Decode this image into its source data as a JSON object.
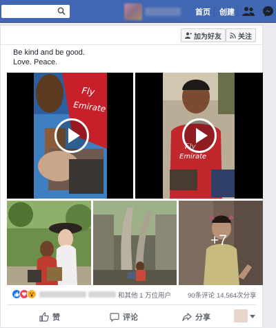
{
  "topbar": {
    "search_placeholder": "",
    "nav": {
      "home": "首页",
      "create": "创建"
    }
  },
  "post": {
    "header_buttons": {
      "add_friend": "加为好友",
      "follow": "关注"
    },
    "text_line1": "Be kind and be good.",
    "text_line2": "Love. Peace.",
    "more_photos": "+7"
  },
  "stats": {
    "others": "和其他 1 万位用户",
    "comments": "90条评论",
    "shares": "14,564次分享"
  },
  "actions": {
    "like": "赞",
    "comment": "评论",
    "share": "分享"
  },
  "colors": {
    "brand": "#4267b2",
    "like_blue": "#1877f2",
    "love_red": "#f33e58",
    "wow_yellow": "#f7b125"
  },
  "icons": [
    "search-icon",
    "friends-icon",
    "messenger-icon",
    "add-friend-icon",
    "rss-icon",
    "like-icon",
    "comment-icon",
    "share-icon"
  ]
}
